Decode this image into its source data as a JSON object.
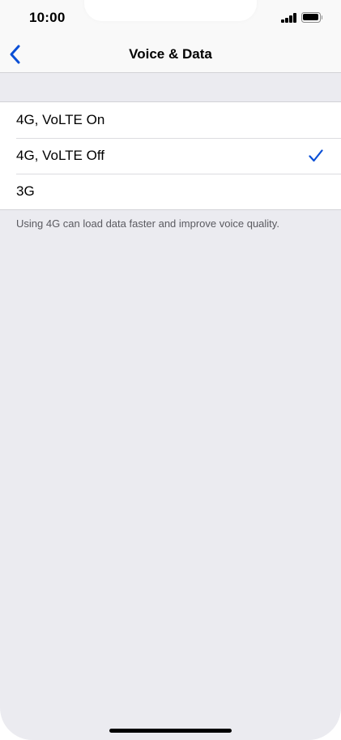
{
  "status_bar": {
    "time": "10:00",
    "signal_icon": "signal-bars-icon",
    "battery_icon": "battery-icon"
  },
  "nav": {
    "back_icon": "chevron-left-icon",
    "title": "Voice & Data"
  },
  "options": [
    {
      "label": "4G, VoLTE On",
      "selected": false
    },
    {
      "label": "4G, VoLTE Off",
      "selected": true
    },
    {
      "label": "3G",
      "selected": false
    }
  ],
  "footer_note": "Using 4G can load data faster and improve voice quality.",
  "colors": {
    "accent": "#0a4fd6",
    "background": "#ebebf0",
    "list_background": "#ffffff"
  }
}
